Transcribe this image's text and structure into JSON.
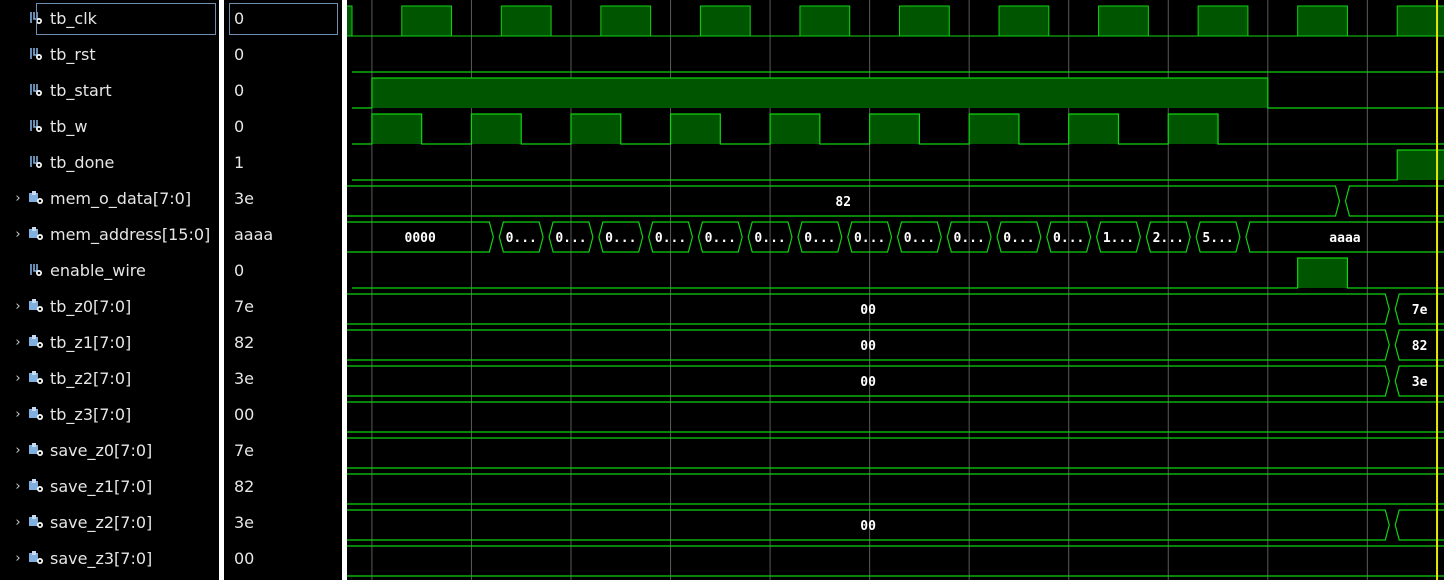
{
  "colors": {
    "wave": "#0fd40f",
    "fill": "#005500",
    "grid": "#5a5a5a",
    "cursor": "#e8e800",
    "bus_text": "#ffffff"
  },
  "signals": [
    {
      "name": "tb_clk",
      "value": "0",
      "kind": "bit",
      "icon": "signal-bit-icon"
    },
    {
      "name": "tb_rst",
      "value": "0",
      "kind": "bit",
      "icon": "signal-bit-icon"
    },
    {
      "name": "tb_start",
      "value": "0",
      "kind": "bit",
      "icon": "signal-bit-icon"
    },
    {
      "name": "tb_w",
      "value": "0",
      "kind": "bit",
      "icon": "signal-bit-icon"
    },
    {
      "name": "tb_done",
      "value": "1",
      "kind": "bit",
      "icon": "signal-bit-icon"
    },
    {
      "name": "mem_o_data[7:0]",
      "value": "3e",
      "kind": "bus",
      "icon": "signal-bus-icon"
    },
    {
      "name": "mem_address[15:0]",
      "value": "aaaa",
      "kind": "bus",
      "icon": "signal-bus-icon"
    },
    {
      "name": "enable_wire",
      "value": "0",
      "kind": "bit",
      "icon": "signal-bit-icon"
    },
    {
      "name": "tb_z0[7:0]",
      "value": "7e",
      "kind": "bus",
      "icon": "signal-bus-icon"
    },
    {
      "name": "tb_z1[7:0]",
      "value": "82",
      "kind": "bus",
      "icon": "signal-bus-icon"
    },
    {
      "name": "tb_z2[7:0]",
      "value": "3e",
      "kind": "bus",
      "icon": "signal-bus-icon"
    },
    {
      "name": "tb_z3[7:0]",
      "value": "00",
      "kind": "bus",
      "icon": "signal-bus-icon"
    },
    {
      "name": "save_z0[7:0]",
      "value": "7e",
      "kind": "bus",
      "icon": "signal-bus-icon"
    },
    {
      "name": "save_z1[7:0]",
      "value": "82",
      "kind": "bus",
      "icon": "signal-bus-icon"
    },
    {
      "name": "save_z2[7:0]",
      "value": "3e",
      "kind": "bus",
      "icon": "signal-bus-icon"
    },
    {
      "name": "save_z3[7:0]",
      "value": "00",
      "kind": "bus",
      "icon": "signal-bus-icon"
    }
  ],
  "waves": {
    "tb_clk": {
      "type": "clock",
      "period_ns": 10,
      "high_ns": 5,
      "start_level": 0,
      "rise_offset_ns": 5
    },
    "tb_rst": {
      "type": "bit",
      "segments": [
        [
          0,
          0
        ]
      ]
    },
    "tb_start": {
      "type": "bit",
      "segments": [
        [
          0,
          0
        ],
        [
          2,
          1
        ],
        [
          92,
          0
        ]
      ]
    },
    "tb_w": {
      "type": "bit",
      "segments": [
        [
          0,
          0
        ],
        [
          2,
          1
        ],
        [
          7,
          0
        ],
        [
          12,
          1
        ],
        [
          17,
          0
        ],
        [
          22,
          1
        ],
        [
          27,
          0
        ],
        [
          32,
          1
        ],
        [
          37,
          0
        ],
        [
          42,
          1
        ],
        [
          47,
          0
        ],
        [
          52,
          1
        ],
        [
          57,
          0
        ],
        [
          62,
          1
        ],
        [
          67,
          0
        ],
        [
          72,
          1
        ],
        [
          77,
          0
        ],
        [
          82,
          1
        ],
        [
          87,
          0
        ]
      ]
    },
    "tb_done": {
      "type": "bit",
      "segments": [
        [
          0,
          0
        ],
        [
          105,
          1
        ]
      ]
    },
    "mem_o_data": {
      "type": "bus",
      "segments": [
        [
          0,
          "82"
        ],
        [
          99.5,
          ""
        ]
      ]
    },
    "mem_address": {
      "type": "bus",
      "segments": [
        [
          0,
          "0000"
        ],
        [
          14.5,
          "0..."
        ],
        [
          19.5,
          "0..."
        ],
        [
          24.5,
          "0..."
        ],
        [
          29.5,
          "0..."
        ],
        [
          34.5,
          "0..."
        ],
        [
          39.5,
          "0..."
        ],
        [
          44.5,
          "0..."
        ],
        [
          49.5,
          "0..."
        ],
        [
          54.5,
          "0..."
        ],
        [
          59.5,
          "0..."
        ],
        [
          64.5,
          "0..."
        ],
        [
          69.5,
          "0..."
        ],
        [
          74.5,
          "1..."
        ],
        [
          79.5,
          "2..."
        ],
        [
          84.5,
          "5..."
        ],
        [
          89.5,
          "aaaa"
        ]
      ]
    },
    "enable_wire": {
      "type": "bit",
      "segments": [
        [
          0,
          0
        ],
        [
          95,
          1
        ],
        [
          100,
          0
        ]
      ]
    },
    "tb_z0": {
      "type": "bus",
      "segments": [
        [
          0,
          "00"
        ],
        [
          104.5,
          "7e"
        ]
      ]
    },
    "tb_z1": {
      "type": "bus",
      "segments": [
        [
          0,
          "00"
        ],
        [
          104.5,
          "82"
        ]
      ]
    },
    "tb_z2": {
      "type": "bus",
      "segments": [
        [
          0,
          "00"
        ],
        [
          104.5,
          "3e"
        ]
      ]
    },
    "tb_z3": {
      "type": "bus",
      "segments": [
        [
          0,
          ""
        ]
      ]
    },
    "save_z0": {
      "type": "bus",
      "segments": [
        [
          0,
          ""
        ]
      ]
    },
    "save_z1": {
      "type": "bus",
      "segments": [
        [
          0,
          ""
        ]
      ]
    },
    "save_z2": {
      "type": "bus",
      "segments": [
        [
          0,
          "00"
        ],
        [
          104.5,
          ""
        ]
      ]
    },
    "save_z3": {
      "type": "bus",
      "segments": [
        [
          0,
          ""
        ]
      ]
    }
  },
  "view": {
    "start_ns": 0,
    "end_ns": 109.7,
    "grid_ns": [
      2,
      12,
      22,
      32,
      42,
      52,
      62,
      72,
      82,
      92,
      102
    ],
    "cursor_ns": 109.0
  }
}
